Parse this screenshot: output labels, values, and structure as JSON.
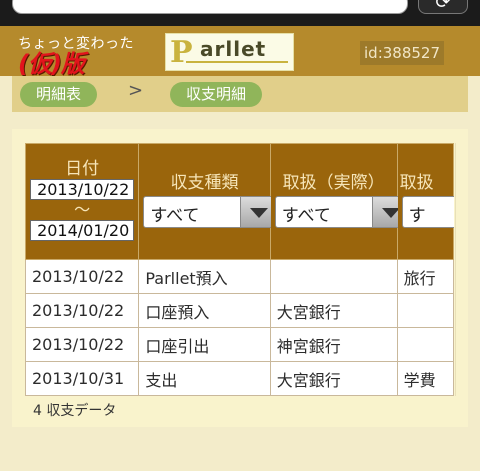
{
  "browser": {
    "reload_icon": "reload-icon",
    "reload_glyph": "⟳"
  },
  "header": {
    "logo_top": "ちょっと変わった",
    "logo_big": "(仮)版",
    "parllet_p": "P",
    "parllet_text": "arllet",
    "user_id": "id:388527"
  },
  "breadcrumb": {
    "items": [
      "明細表",
      "収支明細"
    ],
    "separator": ">"
  },
  "table": {
    "headers": {
      "date": "日付",
      "date_from": "2013/10/22",
      "date_tilde": "〜",
      "date_to": "2014/01/20",
      "type": "収支種類",
      "type_select": "すべて",
      "handling": "取扱（実際）",
      "handling_select": "すべて",
      "col4_partial": "取扱",
      "col4_select": "す"
    },
    "rows": [
      {
        "date": "2013/10/22",
        "type": "Parllet預入",
        "handling": "",
        "col4": "旅行"
      },
      {
        "date": "2013/10/22",
        "type": "口座預入",
        "handling": "大宮銀行",
        "col4": ""
      },
      {
        "date": "2013/10/22",
        "type": "口座引出",
        "handling": "神宮銀行",
        "col4": ""
      },
      {
        "date": "2013/10/31",
        "type": "支出",
        "handling": "大宮銀行",
        "col4": "学費"
      }
    ]
  },
  "footer": {
    "count_text": "4 収支データ"
  },
  "colors": {
    "header_band": "#b58a2c",
    "table_header": "#9a650c",
    "crumb": "#90b55a",
    "background": "#f3ecca"
  }
}
